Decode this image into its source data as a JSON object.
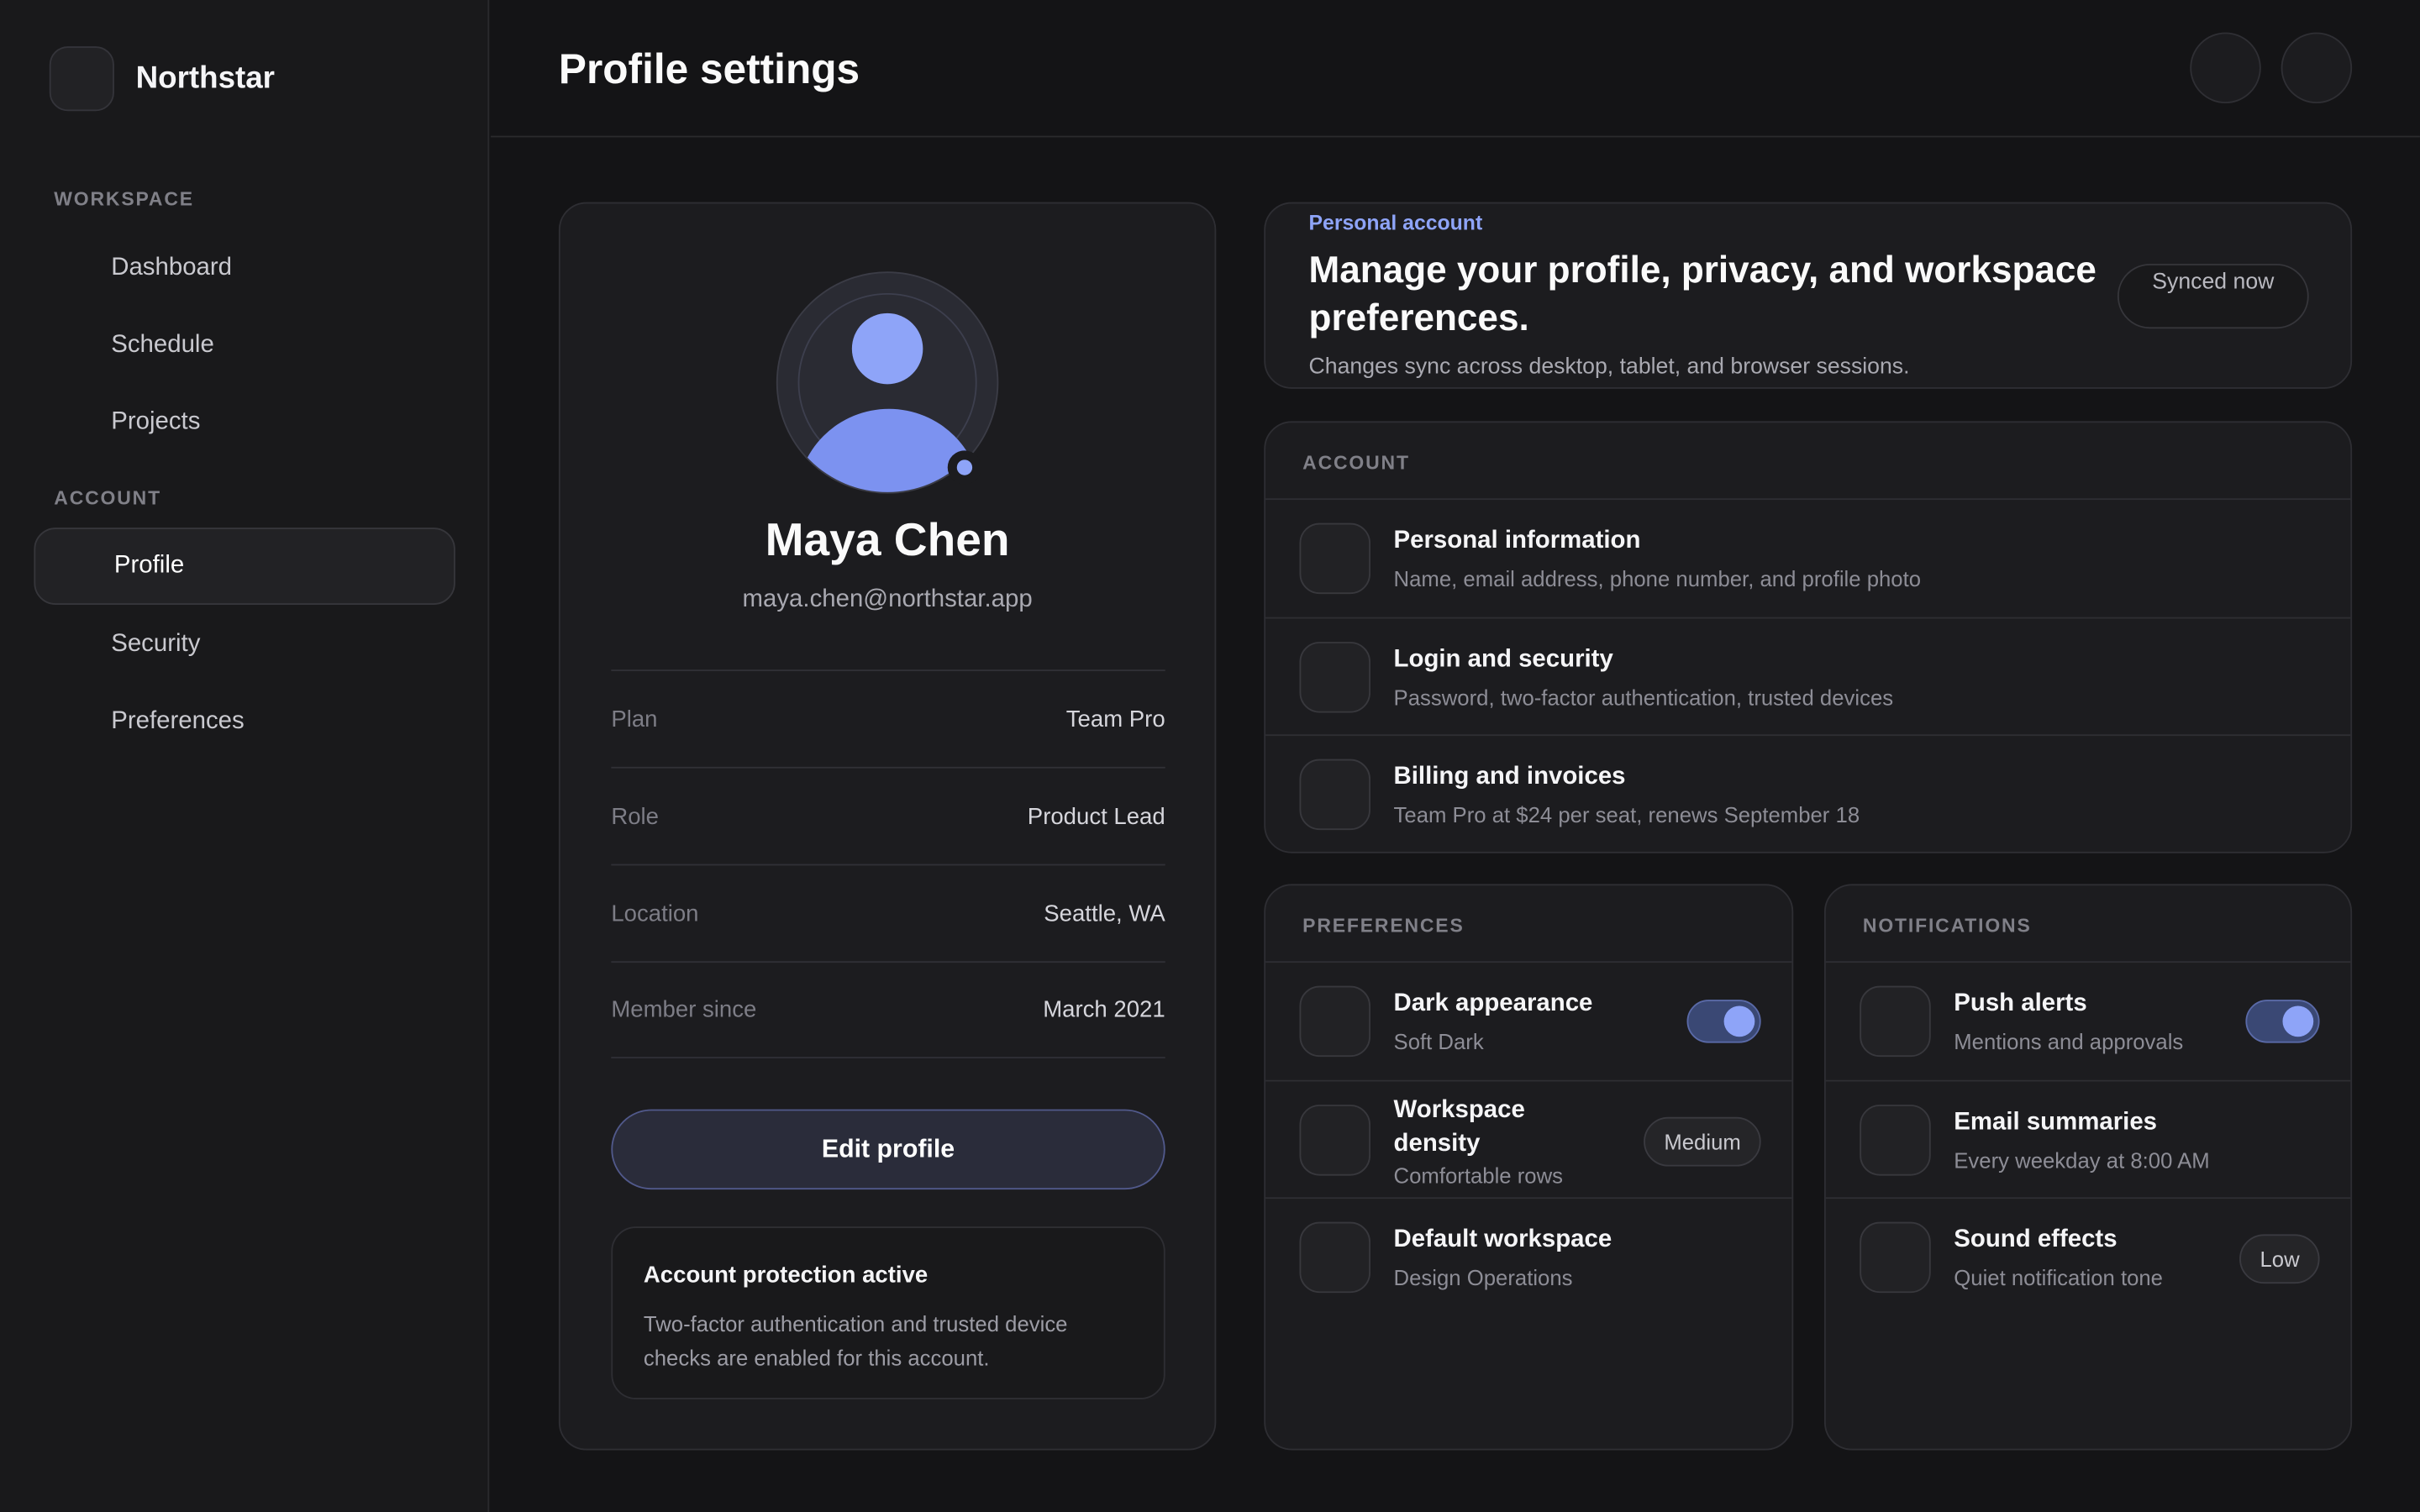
{
  "brand": {
    "name": "Northstar"
  },
  "sidebar": {
    "sections": [
      {
        "label": "WORKSPACE",
        "items": [
          "Dashboard",
          "Schedule",
          "Projects"
        ]
      },
      {
        "label": "ACCOUNT",
        "items": [
          "Profile",
          "Security",
          "Preferences"
        ]
      }
    ],
    "active_item": "Profile"
  },
  "header": {
    "title": "Profile settings"
  },
  "profile": {
    "name": "Maya Chen",
    "email": "maya.chen@northstar.app",
    "details": [
      {
        "label": "Plan",
        "value": "Team Pro"
      },
      {
        "label": "Role",
        "value": "Product Lead"
      },
      {
        "label": "Location",
        "value": "Seattle, WA"
      },
      {
        "label": "Member since",
        "value": "March 2021"
      }
    ],
    "edit_label": "Edit profile",
    "protection": {
      "title": "Account protection active",
      "text": "Two-factor authentication and trusted device checks are enabled for this account."
    }
  },
  "banner": {
    "eyebrow": "Personal account",
    "title": "Manage your profile, privacy, and workspace preferences.",
    "subtitle": "Changes sync across desktop, tablet, and browser sessions.",
    "sync_status": "Synced now"
  },
  "account": {
    "label": "ACCOUNT",
    "rows": [
      {
        "title": "Personal information",
        "sub": "Name, email address, phone number, and profile photo"
      },
      {
        "title": "Login and security",
        "sub": "Password, two-factor authentication, trusted devices"
      },
      {
        "title": "Billing and invoices",
        "sub": "Team Pro at $24 per seat, renews September 18"
      }
    ]
  },
  "preferences": {
    "label": "PREFERENCES",
    "rows": [
      {
        "title": "Dark appearance",
        "sub": "Soft Dark",
        "toggle": true
      },
      {
        "title": "Workspace density",
        "sub": "Comfortable rows",
        "pill": "Medium"
      },
      {
        "title": "Default workspace",
        "sub": "Design Operations"
      }
    ]
  },
  "notifications": {
    "label": "NOTIFICATIONS",
    "rows": [
      {
        "title": "Push alerts",
        "sub": "Mentions and approvals",
        "toggle": true
      },
      {
        "title": "Email summaries",
        "sub": "Every weekday at 8:00 AM"
      },
      {
        "title": "Sound effects",
        "sub": "Quiet notification tone",
        "pill": "Low"
      }
    ]
  },
  "colors": {
    "accent": "#8ea4f8",
    "background": "#141416",
    "card": "#1c1c1f"
  }
}
